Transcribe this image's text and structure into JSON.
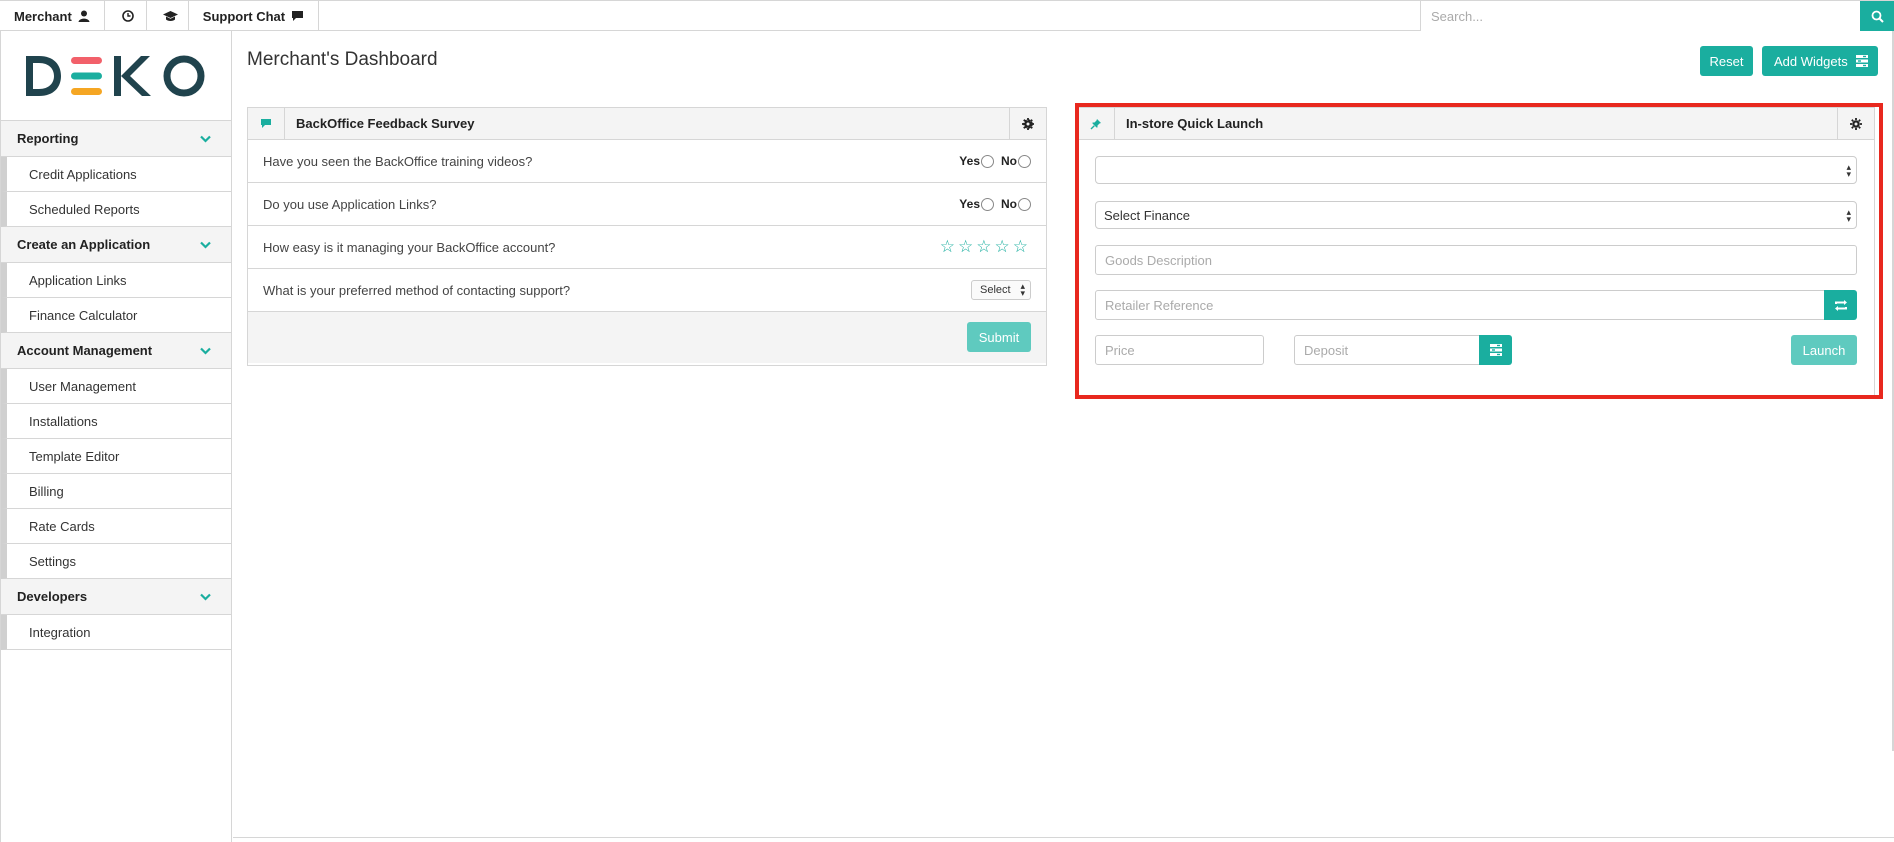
{
  "topbar": {
    "merchant_label": "Merchant",
    "support_chat_label": "Support Chat",
    "search_placeholder": "Search..."
  },
  "brand": {
    "logo_text": "DEKO",
    "accent": "#1aae9f"
  },
  "sidebar": {
    "sections": [
      {
        "title": "Reporting",
        "items": [
          "Credit Applications",
          "Scheduled Reports"
        ]
      },
      {
        "title": "Create an Application",
        "items": [
          "Application Links",
          "Finance Calculator"
        ]
      },
      {
        "title": "Account Management",
        "items": [
          "User Management",
          "Installations",
          "Template Editor",
          "Billing",
          "Rate Cards",
          "Settings"
        ]
      },
      {
        "title": "Developers",
        "items": [
          "Integration"
        ]
      }
    ]
  },
  "main": {
    "title": "Merchant's Dashboard",
    "reset_label": "Reset",
    "add_widgets_label": "Add Widgets"
  },
  "survey": {
    "title": "BackOffice Feedback Survey",
    "q1": "Have you seen the BackOffice training videos?",
    "q2": "Do you use Application Links?",
    "q3": "How easy is it managing your BackOffice account?",
    "q4": "What is your preferred method of contacting support?",
    "yes_label": "Yes",
    "no_label": "No",
    "rating_stars": 5,
    "select_label": "Select",
    "submit_label": "Submit"
  },
  "quick_launch": {
    "title": "In-store Quick Launch",
    "first_select_value": "",
    "finance_select": "Select Finance",
    "goods_placeholder": "Goods Description",
    "retailer_placeholder": "Retailer Reference",
    "price_placeholder": "Price",
    "deposit_placeholder": "Deposit",
    "launch_label": "Launch"
  }
}
